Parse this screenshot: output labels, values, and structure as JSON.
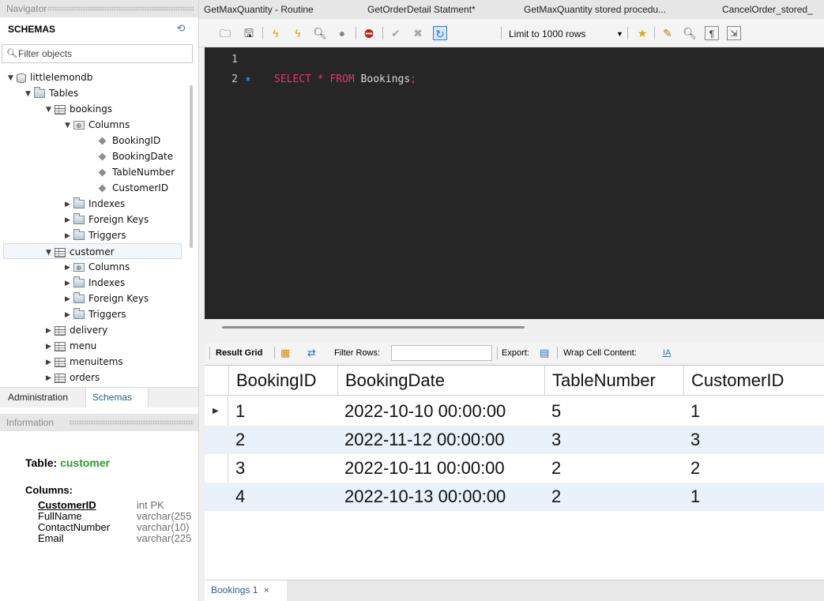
{
  "navigator": {
    "header": "Navigator",
    "schemas_title": "SCHEMAS",
    "filter_placeholder": "Filter objects",
    "tree": {
      "db": "littlelemondb",
      "tables": "Tables",
      "bookings": "bookings",
      "columns": "Columns",
      "booking_cols": [
        "BookingID",
        "BookingDate",
        "TableNumber",
        "CustomerID"
      ],
      "indexes": "Indexes",
      "foreign_keys": "Foreign Keys",
      "triggers": "Triggers",
      "customer": "customer",
      "other_tables": [
        "delivery",
        "menu",
        "menuitems",
        "orders"
      ]
    },
    "tabs": {
      "administration": "Administration",
      "schemas": "Schemas"
    }
  },
  "information": {
    "header": "Information",
    "table_label": "Table:",
    "table_name": "customer",
    "columns_label": "Columns:",
    "columns": [
      {
        "name": "CustomerID",
        "type": "int PK"
      },
      {
        "name": "FullName",
        "type": "varchar(255"
      },
      {
        "name": "ContactNumber",
        "type": "varchar(10)"
      },
      {
        "name": "Email",
        "type": "varchar(225"
      }
    ]
  },
  "editor_tabs": [
    "GetMaxQuantity - Routine",
    "GetOrderDetail Statment*",
    "GetMaxQuantity stored procedu...",
    "CancelOrder_stored_"
  ],
  "toolbar": {
    "limit": "Limit to 1000 rows"
  },
  "editor": {
    "lines": [
      {
        "num": "1",
        "kw1": "",
        "mid": "",
        "kw2": "",
        "tail": ""
      },
      {
        "num": "2",
        "kw1": "SELECT * FROM",
        "mid": " Bookings",
        "kw2": ";",
        "tail": ""
      }
    ]
  },
  "result_toolbar": {
    "result_grid": "Result Grid",
    "filter_rows": "Filter Rows:",
    "export": "Export:",
    "wrap": "Wrap Cell Content:"
  },
  "grid": {
    "columns": [
      "BookingID",
      "BookingDate",
      "TableNumber",
      "CustomerID"
    ],
    "rows": [
      [
        "1",
        "2022-10-10 00:00:00",
        "5",
        "1"
      ],
      [
        "2",
        "2022-11-12 00:00:00",
        "3",
        "3"
      ],
      [
        "3",
        "2022-10-11 00:00:00",
        "2",
        "2"
      ],
      [
        "4",
        "2022-10-13 00:00:00",
        "2",
        "1"
      ]
    ]
  },
  "result_tab": {
    "label": "Bookings 1",
    "close": "×"
  }
}
